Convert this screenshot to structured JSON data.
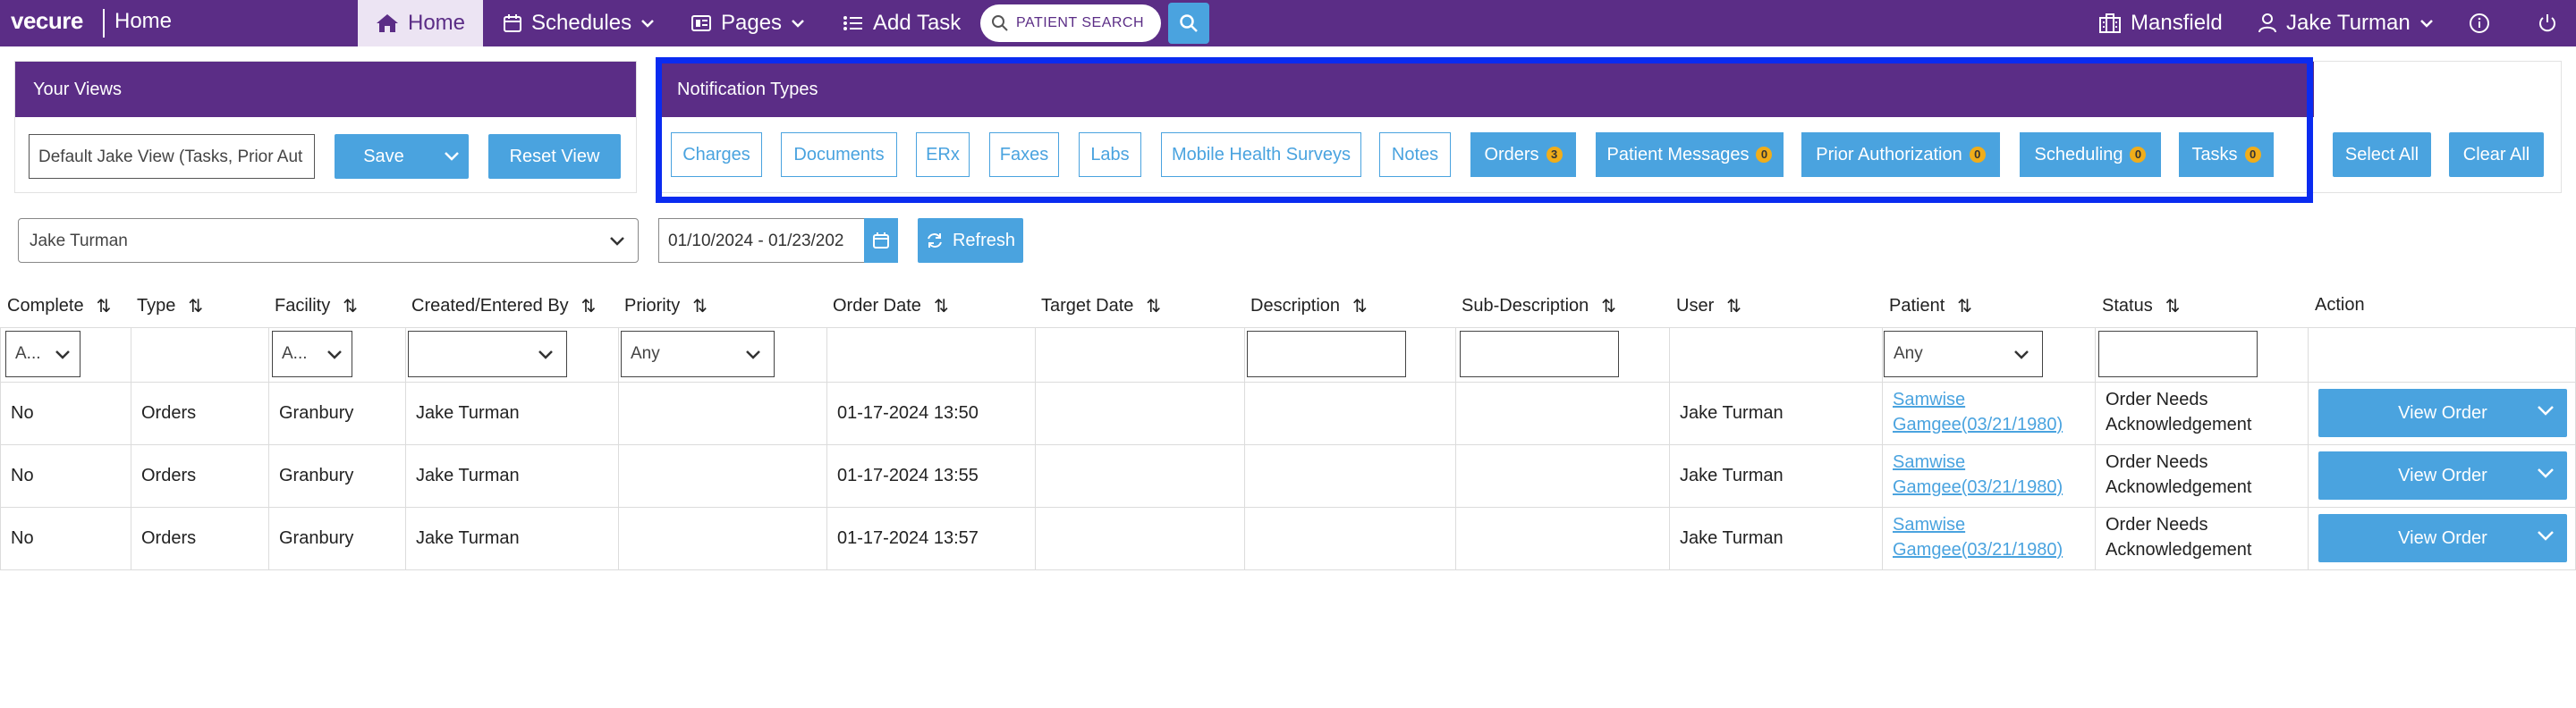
{
  "app": {
    "logo": "vecure",
    "page": "Home"
  },
  "nav": {
    "home": "Home",
    "schedules": "Schedules",
    "pages": "Pages",
    "add_task": "Add Task",
    "search_placeholder": "PATIENT SEARCH",
    "location": "Mansfield",
    "user": "Jake Turman"
  },
  "your_views": {
    "title": "Your Views",
    "selected_view": "Default Jake View (Tasks, Prior Aut",
    "save": "Save",
    "reset": "Reset View"
  },
  "notification_types": {
    "title": "Notification Types",
    "outline_items": [
      "Charges",
      "Documents",
      "ERx",
      "Faxes",
      "Labs",
      "Mobile Health Surveys",
      "Notes"
    ],
    "active_items": [
      {
        "label": "Orders",
        "count": "3"
      },
      {
        "label": "Patient Messages",
        "count": "0"
      },
      {
        "label": "Prior Authorization",
        "count": "0"
      },
      {
        "label": "Scheduling",
        "count": "0"
      },
      {
        "label": "Tasks",
        "count": "0"
      }
    ],
    "select_all": "Select All",
    "clear_all": "Clear All"
  },
  "filters": {
    "user": "Jake Turman",
    "date_range": "01/10/2024 - 01/23/202",
    "refresh": "Refresh"
  },
  "table": {
    "headers": [
      "Complete",
      "Type",
      "Facility",
      "Created/Entered By",
      "Priority",
      "Order Date",
      "Target Date",
      "Description",
      "Sub-Description",
      "User",
      "Patient",
      "Status",
      "Action"
    ],
    "filter_values": {
      "complete": "A...",
      "facility": "A...",
      "priority": "Any",
      "patient": "Any"
    },
    "rows": [
      {
        "complete": "No",
        "type": "Orders",
        "facility": "Granbury",
        "created_by": "Jake Turman",
        "order_date": "01-17-2024 13:50",
        "user": "Jake Turman",
        "patient_line1": "Samwise",
        "patient_line2": "Gamgee(03/21/1980)",
        "status_line1": "Order Needs",
        "status_line2": "Acknowledgement",
        "action": "View Order"
      },
      {
        "complete": "No",
        "type": "Orders",
        "facility": "Granbury",
        "created_by": "Jake Turman",
        "order_date": "01-17-2024 13:55",
        "user": "Jake Turman",
        "patient_line1": "Samwise",
        "patient_line2": "Gamgee(03/21/1980)",
        "status_line1": "Order Needs",
        "status_line2": "Acknowledgement",
        "action": "View Order"
      },
      {
        "complete": "No",
        "type": "Orders",
        "facility": "Granbury",
        "created_by": "Jake Turman",
        "order_date": "01-17-2024 13:57",
        "user": "Jake Turman",
        "patient_line1": "Samwise",
        "patient_line2": "Gamgee(03/21/1980)",
        "status_line1": "Order Needs",
        "status_line2": "Acknowledgement",
        "action": "View Order"
      }
    ]
  },
  "colors": {
    "brand": "#5b2d86",
    "accent": "#4aa3df",
    "badge": "#f0ad1a",
    "highlight": "#0a2bf0"
  }
}
